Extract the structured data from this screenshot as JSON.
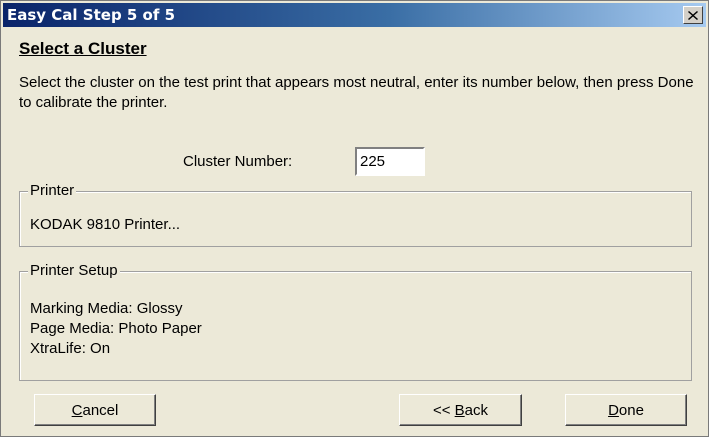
{
  "window": {
    "title": "Easy Cal Step 5 of 5"
  },
  "heading": "Select a Cluster",
  "instructions": "Select the cluster on the test print that appears most neutral, enter its number below, then press Done to calibrate the printer.",
  "cluster": {
    "label": "Cluster Number:",
    "value": "225"
  },
  "printer_group": {
    "legend": "Printer",
    "name": "KODAK 9810 Printer..."
  },
  "setup_group": {
    "legend": "Printer Setup",
    "lines": [
      "Marking Media: Glossy",
      "Page Media: Photo Paper",
      "XtraLife: On"
    ]
  },
  "buttons": {
    "cancel": {
      "mnemonic": "C",
      "rest": "ancel"
    },
    "back": {
      "prefix": "<< ",
      "mnemonic": "B",
      "rest": "ack"
    },
    "done": {
      "mnemonic": "D",
      "rest": "one"
    }
  }
}
